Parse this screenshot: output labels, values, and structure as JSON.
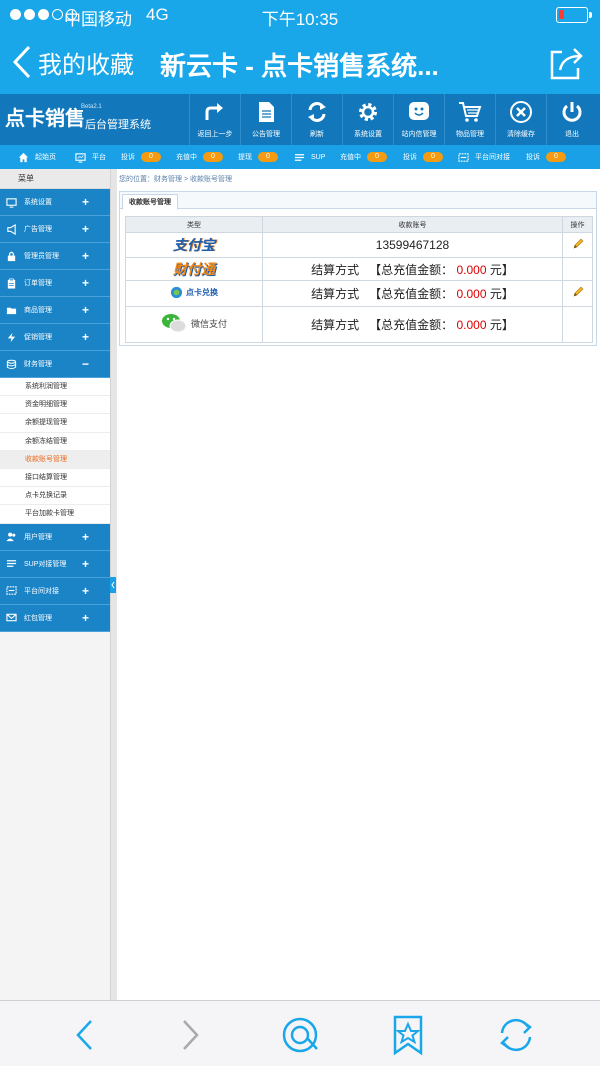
{
  "status_bar": {
    "carrier": "中国移动",
    "network": "4G",
    "time": "下午10:35",
    "battery_percent": 20
  },
  "nav": {
    "back_label": "我的收藏",
    "title": "新云卡 - 点卡销售系统..."
  },
  "header": {
    "logo_main": "点卡销售",
    "logo_version": "Beta2.1",
    "logo_sub": "后台管理系统",
    "toolbar": [
      {
        "label": "返回上一步",
        "icon": "redo-arrow-icon"
      },
      {
        "label": "公告管理",
        "icon": "document-icon"
      },
      {
        "label": "刷新",
        "icon": "refresh-icon"
      },
      {
        "label": "系统设置",
        "icon": "gear-icon"
      },
      {
        "label": "站内信管理",
        "icon": "message-icon"
      },
      {
        "label": "物品管理",
        "icon": "cart-icon"
      },
      {
        "label": "清除缓存",
        "icon": "close-circle-icon"
      },
      {
        "label": "退出",
        "icon": "power-icon"
      }
    ]
  },
  "info_strip": {
    "home": "起始页",
    "platform": "平台",
    "complaint1": "投诉",
    "complaint1_count": "0",
    "recharging1": "充值中",
    "recharging1_count": "0",
    "withdraw": "提现",
    "withdraw_count": "0",
    "sup": "SUP",
    "recharging2": "充值中",
    "recharging2_count": "0",
    "complaint2": "投诉",
    "complaint2_count": "0",
    "platform_dock": "平台间对接",
    "complaint3": "投诉",
    "complaint3_count": "0"
  },
  "sidebar": {
    "title": "菜单",
    "items_top": [
      {
        "label": "系统设置",
        "icon": "monitor-icon"
      },
      {
        "label": "广告管理",
        "icon": "megaphone-icon"
      },
      {
        "label": "管理员管理",
        "icon": "lock-icon"
      },
      {
        "label": "订单管理",
        "icon": "clipboard-icon"
      },
      {
        "label": "商品管理",
        "icon": "folder-icon"
      },
      {
        "label": "促销管理",
        "icon": "bolt-icon"
      }
    ],
    "expanded": {
      "label": "财务管理",
      "icon": "database-icon"
    },
    "sub_items": [
      "系统利润管理",
      "资金明细管理",
      "余额提现管理",
      "余额冻结管理",
      "收款账号管理",
      "接口结算管理",
      "点卡兑换记录",
      "平台加款卡管理"
    ],
    "active_sub": 4,
    "items_bottom": [
      {
        "label": "用户管理",
        "icon": "users-icon"
      },
      {
        "label": "SUP对接管理",
        "icon": "list-icon"
      },
      {
        "label": "平台间对接",
        "icon": "link-icon"
      },
      {
        "label": "红包管理",
        "icon": "envelope-icon"
      }
    ]
  },
  "main": {
    "breadcrumb": "您的位置：财务管理 > 收款账号管理",
    "tab_label": "收款账号管理",
    "table": {
      "col_type": "类型",
      "col_account": "收款账号",
      "col_op": "操作",
      "rows": [
        {
          "brand": "支付宝",
          "account": "13599467128",
          "editable": true
        },
        {
          "brand": "财付通",
          "settle_label": "结算方式",
          "total_label": "【总充值金额：",
          "amount": "0.000",
          "unit": "元】",
          "editable": false
        },
        {
          "brand": "点卡兑换",
          "settle_label": "结算方式",
          "total_label": "【总充值金额：",
          "amount": "0.000",
          "unit": "元】",
          "editable": true
        },
        {
          "brand": "微信支付",
          "settle_label": "结算方式",
          "total_label": "【总充值金额：",
          "amount": "0.000",
          "unit": "元】",
          "editable": false
        }
      ]
    }
  },
  "colors": {
    "ios_blue": "#1aa7ea",
    "header_blue": "#1278bb",
    "strip_blue": "#1aa0e6",
    "sidebar_blue": "#1a84c7",
    "badge_orange": "#f59b12",
    "amount_red": "#e00000",
    "active_orange": "#ec6a1c"
  }
}
